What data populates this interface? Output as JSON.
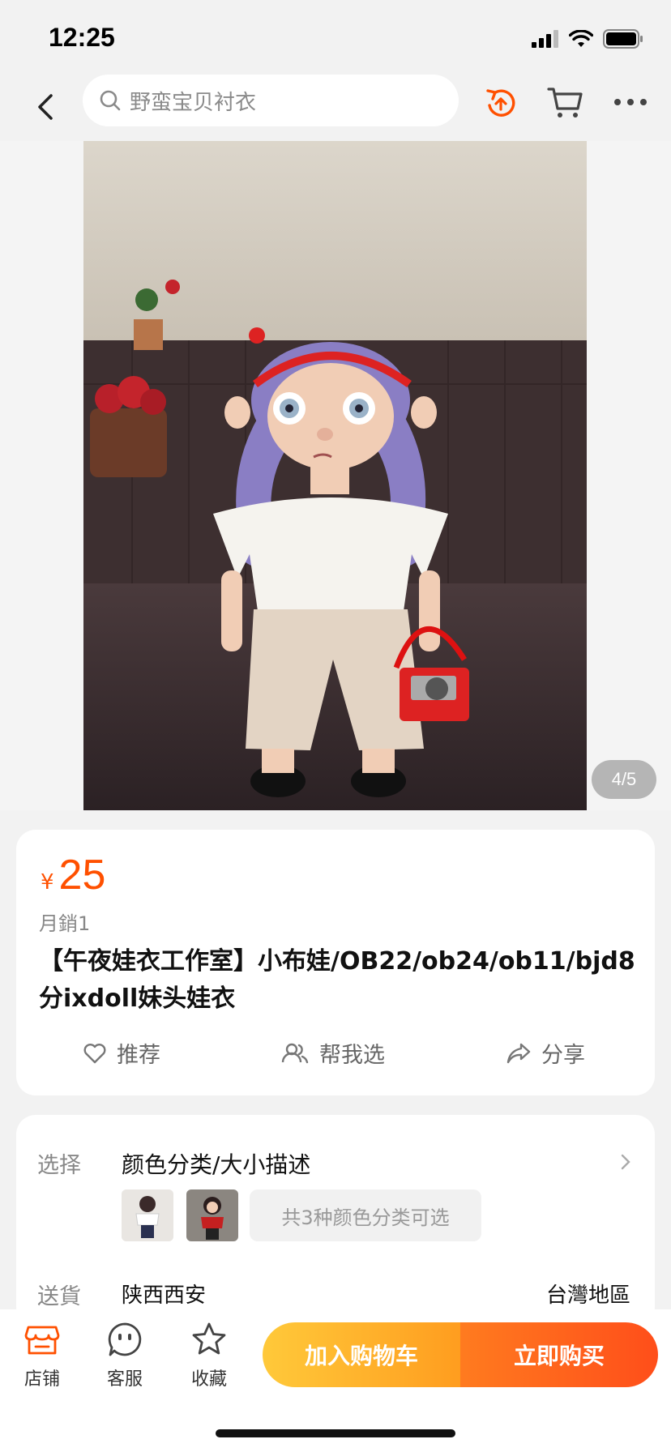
{
  "status_bar": {
    "time": "12:25"
  },
  "nav": {
    "search_text": "野蛮宝贝衬衣",
    "accent_color": "#ff5000"
  },
  "gallery": {
    "page_indicator": "4/5"
  },
  "product": {
    "currency_symbol": "¥",
    "price": "25",
    "monthly_sales": "月銷1",
    "title": "【午夜娃衣工作室】小布娃/OB22/ob24/ob11/bjd8分ixdoll妹头娃衣",
    "actions": [
      {
        "label": "推荐",
        "icon": "heart-icon"
      },
      {
        "label": "帮我选",
        "icon": "people-icon"
      },
      {
        "label": "分享",
        "icon": "share-icon"
      }
    ]
  },
  "options": {
    "select_label": "选择",
    "select_value": "颜色分类/大小描述",
    "variant_summary": "共3种颜色分类可选",
    "ship_label": "送貨",
    "ship_from": "陕西西安",
    "ship_to": "台灣地區"
  },
  "bottom_bar": {
    "items": [
      {
        "label": "店铺",
        "icon": "store-icon"
      },
      {
        "label": "客服",
        "icon": "customer-service-icon"
      },
      {
        "label": "收藏",
        "icon": "star-icon"
      }
    ],
    "add_to_cart": "加入购物车",
    "buy_now": "立即购买"
  }
}
